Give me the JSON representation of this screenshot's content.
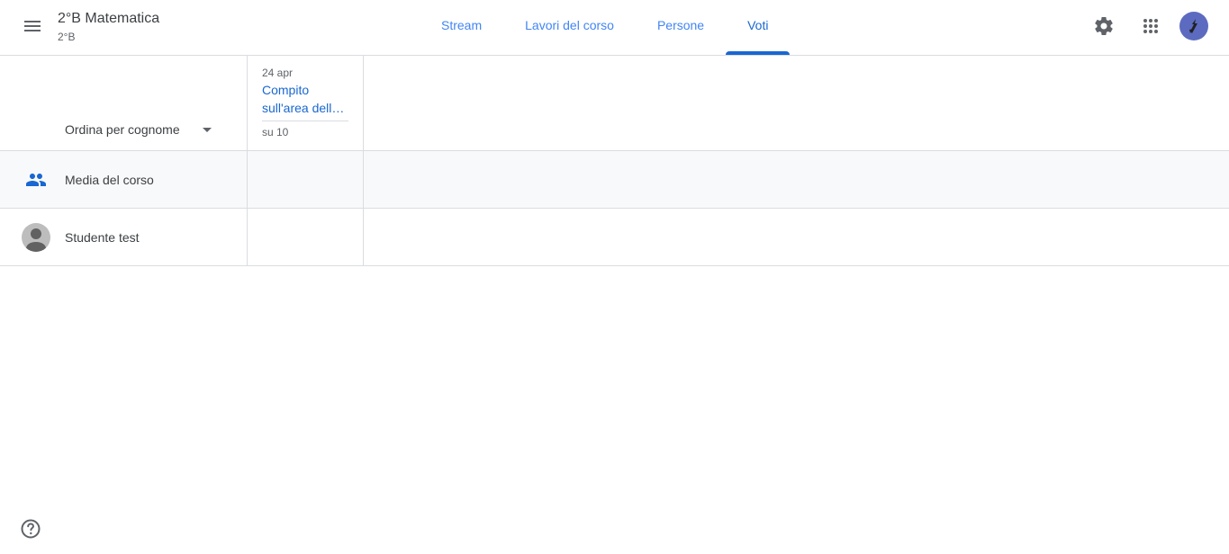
{
  "header": {
    "course_title": "2°B Matematica",
    "course_section": "2°B",
    "tabs": [
      {
        "label": "Stream",
        "active": false
      },
      {
        "label": "Lavori del corso",
        "active": false
      },
      {
        "label": "Persone",
        "active": false
      },
      {
        "label": "Voti",
        "active": true
      }
    ],
    "icons": {
      "menu": "menu-icon",
      "settings": "gear-icon",
      "apps": "apps-grid-icon",
      "account": "avatar"
    },
    "avatar_color": "#5c6bc0"
  },
  "grades": {
    "sort_label": "Ordina per cognome",
    "assignments": [
      {
        "date": "24 apr",
        "title": "Compito sull'area della superficie",
        "points": "su 10"
      }
    ],
    "rows": [
      {
        "type": "class-average",
        "label": "Media del corso",
        "icon": "people-icon"
      },
      {
        "type": "student",
        "label": "Studente test",
        "icon": "student-avatar"
      }
    ]
  },
  "footer": {
    "help_icon": "help-icon"
  },
  "colors": {
    "accent": "#1967d2",
    "tab_inactive": "#4285f4",
    "border": "#dadce0",
    "avg_row_bg": "#f8f9fa"
  }
}
